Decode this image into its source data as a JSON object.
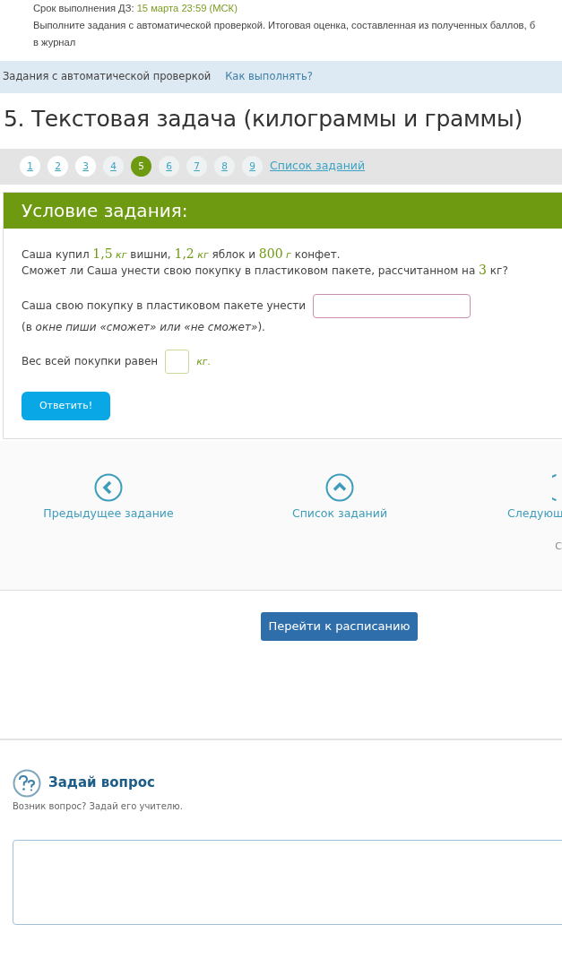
{
  "header": {
    "deadline_label": "Срок выполнения ДЗ:",
    "deadline_value": "15 марта 23:59 (МСК)",
    "info_lines": [
      "Выполните задания с автоматической проверкой. Итоговая оценка, составленная из полученных баллов, б",
      "в журнал"
    ]
  },
  "breadcrumb": {
    "label": "Задания с автоматической проверкой",
    "link": "Как выполнять?"
  },
  "title": "5. Текстовая задача (килограммы и граммы)",
  "pager": {
    "pages": [
      {
        "label": "1",
        "selected": false,
        "done": true
      },
      {
        "label": "2",
        "selected": false,
        "done": true
      },
      {
        "label": "3",
        "selected": false,
        "done": true
      },
      {
        "label": "4",
        "selected": false,
        "done": false
      },
      {
        "label": "5",
        "selected": true,
        "done": false
      },
      {
        "label": "6",
        "selected": false,
        "done": false
      },
      {
        "label": "7",
        "selected": false,
        "done": false
      },
      {
        "label": "8",
        "selected": false,
        "done": false
      },
      {
        "label": "9",
        "selected": false,
        "done": false
      }
    ],
    "list_link": "Список заданий"
  },
  "task": {
    "heading": "Условие задания:",
    "statement": [
      [
        {
          "kind": "plain",
          "text": "Саша купил "
        },
        {
          "kind": "num",
          "text": "1,5"
        },
        {
          "kind": "unit",
          "text": " кг"
        },
        {
          "kind": "plain",
          "text": " вишни, "
        },
        {
          "kind": "num",
          "text": "1,2"
        },
        {
          "kind": "unit",
          "text": " кг"
        },
        {
          "kind": "plain",
          "text": " яблок и "
        },
        {
          "kind": "num",
          "text": "800"
        },
        {
          "kind": "unit",
          "text": " г"
        },
        {
          "kind": "plain",
          "text": " конфет."
        }
      ],
      [
        {
          "kind": "plain",
          "text": "Сможет ли Саша унести свою покупку в пластиковом пакете, рассчитанном на "
        },
        {
          "kind": "num",
          "text": "3"
        },
        {
          "kind": "plain",
          "text": " кг?"
        }
      ]
    ],
    "q1_label": "Саша свою покупку в пластиковом пакете унести",
    "q1_hint": "(в *окне пиши «сможет» или «не сможет»*).",
    "q2_label": "Вес всей покупки равен",
    "q2_unit": "кг.",
    "submit": "Ответить!"
  },
  "nav": {
    "prev": "Предыдущее задание",
    "list": "Список заданий",
    "next": "Следующ",
    "corner": "С"
  },
  "schedule_button": "Перейти к расписанию",
  "ask": {
    "title": "Задай вопрос",
    "subtitle": "Возник вопрос? Задай его учителю."
  }
}
